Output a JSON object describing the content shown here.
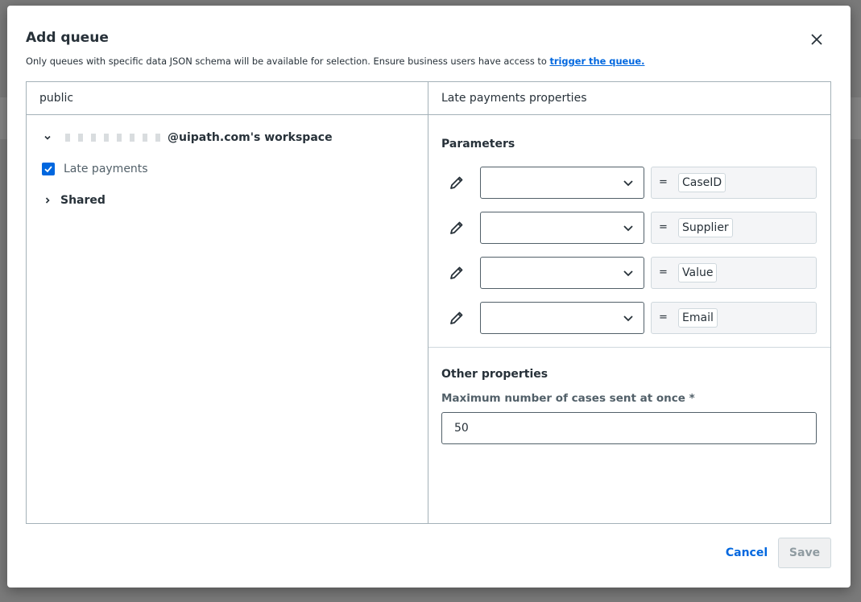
{
  "dialog": {
    "title": "Add queue",
    "subtitle": "Only queues with specific data JSON schema will be available for selection. Ensure business users have access to",
    "subtitle_link": "trigger the queue."
  },
  "left": {
    "header": "public",
    "workspace_label": "@uipath.com's workspace",
    "late_payments": "Late payments",
    "late_payments_checked": true,
    "shared": "Shared"
  },
  "right": {
    "header": "Late payments properties",
    "parameters_title": "Parameters",
    "parameters": [
      {
        "select_value": "",
        "equals": "=",
        "name": "CaseID"
      },
      {
        "select_value": "",
        "equals": "=",
        "name": "Supplier"
      },
      {
        "select_value": "",
        "equals": "=",
        "name": "Value"
      },
      {
        "select_value": "",
        "equals": "=",
        "name": "Email"
      }
    ],
    "other_title": "Other properties",
    "max_label": "Maximum number of cases sent at once *",
    "max_value": "50"
  },
  "footer": {
    "cancel": "Cancel",
    "save": "Save"
  },
  "icons": {
    "close": "close-icon",
    "expand": "chevron-down-icon",
    "collapse": "chevron-right-icon",
    "edit": "pencil-icon",
    "dropdown": "chevron-down-icon",
    "checkbox": "check-icon"
  },
  "colors": {
    "accent": "#0067df",
    "text": "#273139",
    "border": "#a4b1b8",
    "disabled_button": "#eff0f1"
  }
}
